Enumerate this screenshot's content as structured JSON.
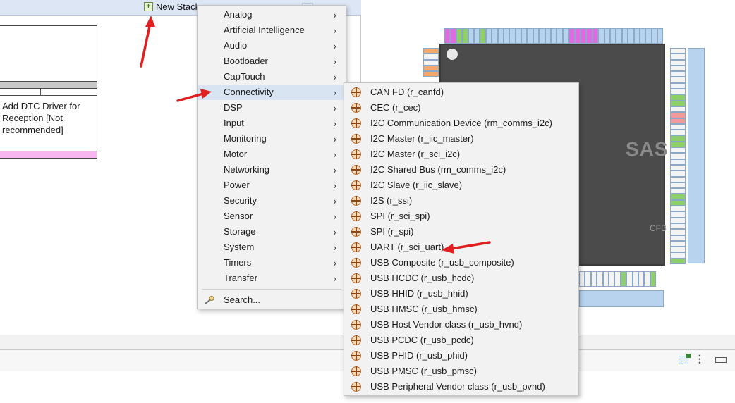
{
  "toolbar": {
    "new_stack_label": "New Stack"
  },
  "stack_blocks": {
    "dtc_block_text": "Add DTC Driver for Reception [Not recommended]"
  },
  "pinout": {
    "logo_text": "SAS",
    "package_text": "CFB"
  },
  "category_menu": {
    "items": [
      {
        "label": "Analog"
      },
      {
        "label": "Artificial Intelligence"
      },
      {
        "label": "Audio"
      },
      {
        "label": "Bootloader"
      },
      {
        "label": "CapTouch"
      },
      {
        "label": "Connectivity"
      },
      {
        "label": "DSP"
      },
      {
        "label": "Input"
      },
      {
        "label": "Monitoring"
      },
      {
        "label": "Motor"
      },
      {
        "label": "Networking"
      },
      {
        "label": "Power"
      },
      {
        "label": "Security"
      },
      {
        "label": "Sensor"
      },
      {
        "label": "Storage"
      },
      {
        "label": "System"
      },
      {
        "label": "Timers"
      },
      {
        "label": "Transfer"
      }
    ],
    "search_label": "Search...",
    "highlighted": "Connectivity"
  },
  "connectivity_menu": {
    "items": [
      {
        "label": "CAN FD (r_canfd)"
      },
      {
        "label": "CEC (r_cec)"
      },
      {
        "label": "I2C Communication Device (rm_comms_i2c)"
      },
      {
        "label": "I2C Master (r_iic_master)"
      },
      {
        "label": "I2C Master (r_sci_i2c)"
      },
      {
        "label": "I2C Shared Bus (rm_comms_i2c)"
      },
      {
        "label": "I2C Slave (r_iic_slave)"
      },
      {
        "label": "I2S (r_ssi)"
      },
      {
        "label": "SPI (r_sci_spi)"
      },
      {
        "label": "SPI (r_spi)"
      },
      {
        "label": "UART (r_sci_uart)"
      },
      {
        "label": "USB Composite (r_usb_composite)"
      },
      {
        "label": "USB HCDC (r_usb_hcdc)"
      },
      {
        "label": "USB HHID (r_usb_hhid)"
      },
      {
        "label": "USB HMSC (r_usb_hmsc)"
      },
      {
        "label": "USB Host Vendor class (r_usb_hvnd)"
      },
      {
        "label": "USB PCDC (r_usb_pcdc)"
      },
      {
        "label": "USB PHID (r_usb_phid)"
      },
      {
        "label": "USB PMSC (r_usb_pmsc)"
      },
      {
        "label": "USB Peripheral Vendor class (r_usb_pvnd)"
      }
    ]
  },
  "colors": {
    "menu_bg": "#f2f2f2",
    "menu_highlight": "#d9e4f2",
    "annotation_red": "#e02020"
  }
}
